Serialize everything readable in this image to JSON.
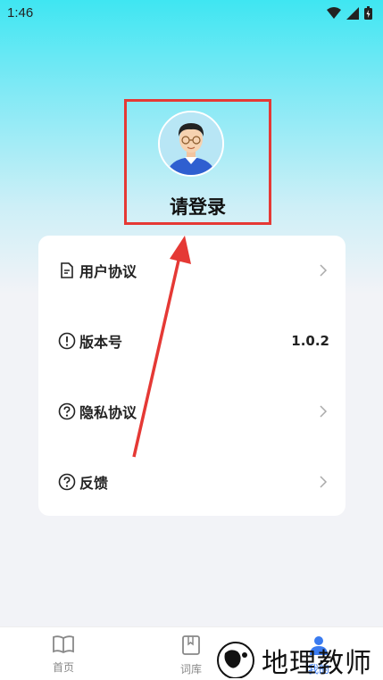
{
  "status_bar": {
    "time": "1:46"
  },
  "profile": {
    "login_label": "请登录"
  },
  "menu": {
    "items": [
      {
        "label": "用户协议",
        "icon": "document-icon",
        "value": ""
      },
      {
        "label": "版本号",
        "icon": "info-icon",
        "value": "1.0.2"
      },
      {
        "label": "隐私协议",
        "icon": "question-icon",
        "value": ""
      },
      {
        "label": "反馈",
        "icon": "question-icon",
        "value": ""
      }
    ]
  },
  "tabbar": {
    "tabs": [
      {
        "label": "首页",
        "icon": "book-icon"
      },
      {
        "label": "词库",
        "icon": "bookmark-icon"
      },
      {
        "label": "我的",
        "icon": "user-icon"
      }
    ]
  },
  "watermark": {
    "text": "地理教师"
  },
  "colors": {
    "accent": "#3a7bf0",
    "highlight": "#e53935",
    "gradient_top": "#3fe6f2"
  }
}
